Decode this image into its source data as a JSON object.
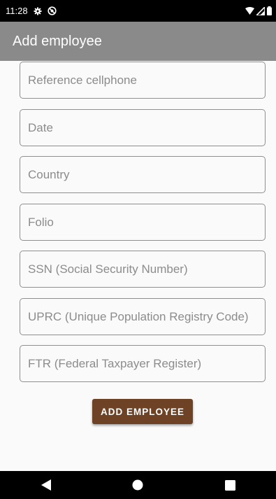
{
  "status_bar": {
    "time": "11:28",
    "icons": [
      "settings-icon",
      "do-not-disturb-icon",
      "wifi-icon",
      "signal-icon",
      "battery-icon"
    ]
  },
  "app_bar": {
    "title": "Add employee"
  },
  "form": {
    "fields": [
      {
        "placeholder": "Reference cellphone",
        "value": ""
      },
      {
        "placeholder": "Date",
        "value": ""
      },
      {
        "placeholder": "Country",
        "value": ""
      },
      {
        "placeholder": "Folio",
        "value": ""
      },
      {
        "placeholder": "SSN (Social Security Number)",
        "value": ""
      },
      {
        "placeholder": "UPRC (Unique Population Registry Code)",
        "value": ""
      },
      {
        "placeholder": "FTR (Federal Taxpayer Register)",
        "value": ""
      }
    ],
    "submit_label": "ADD EMPLOYEE"
  },
  "nav_bar": {
    "icons": [
      "back-icon",
      "home-icon",
      "recents-icon"
    ]
  },
  "colors": {
    "status_bar": "#000000",
    "app_bar": "#8a8a8a",
    "button": "#6d4225",
    "field_border": "#8f8f8f",
    "background": "#fafafa"
  }
}
